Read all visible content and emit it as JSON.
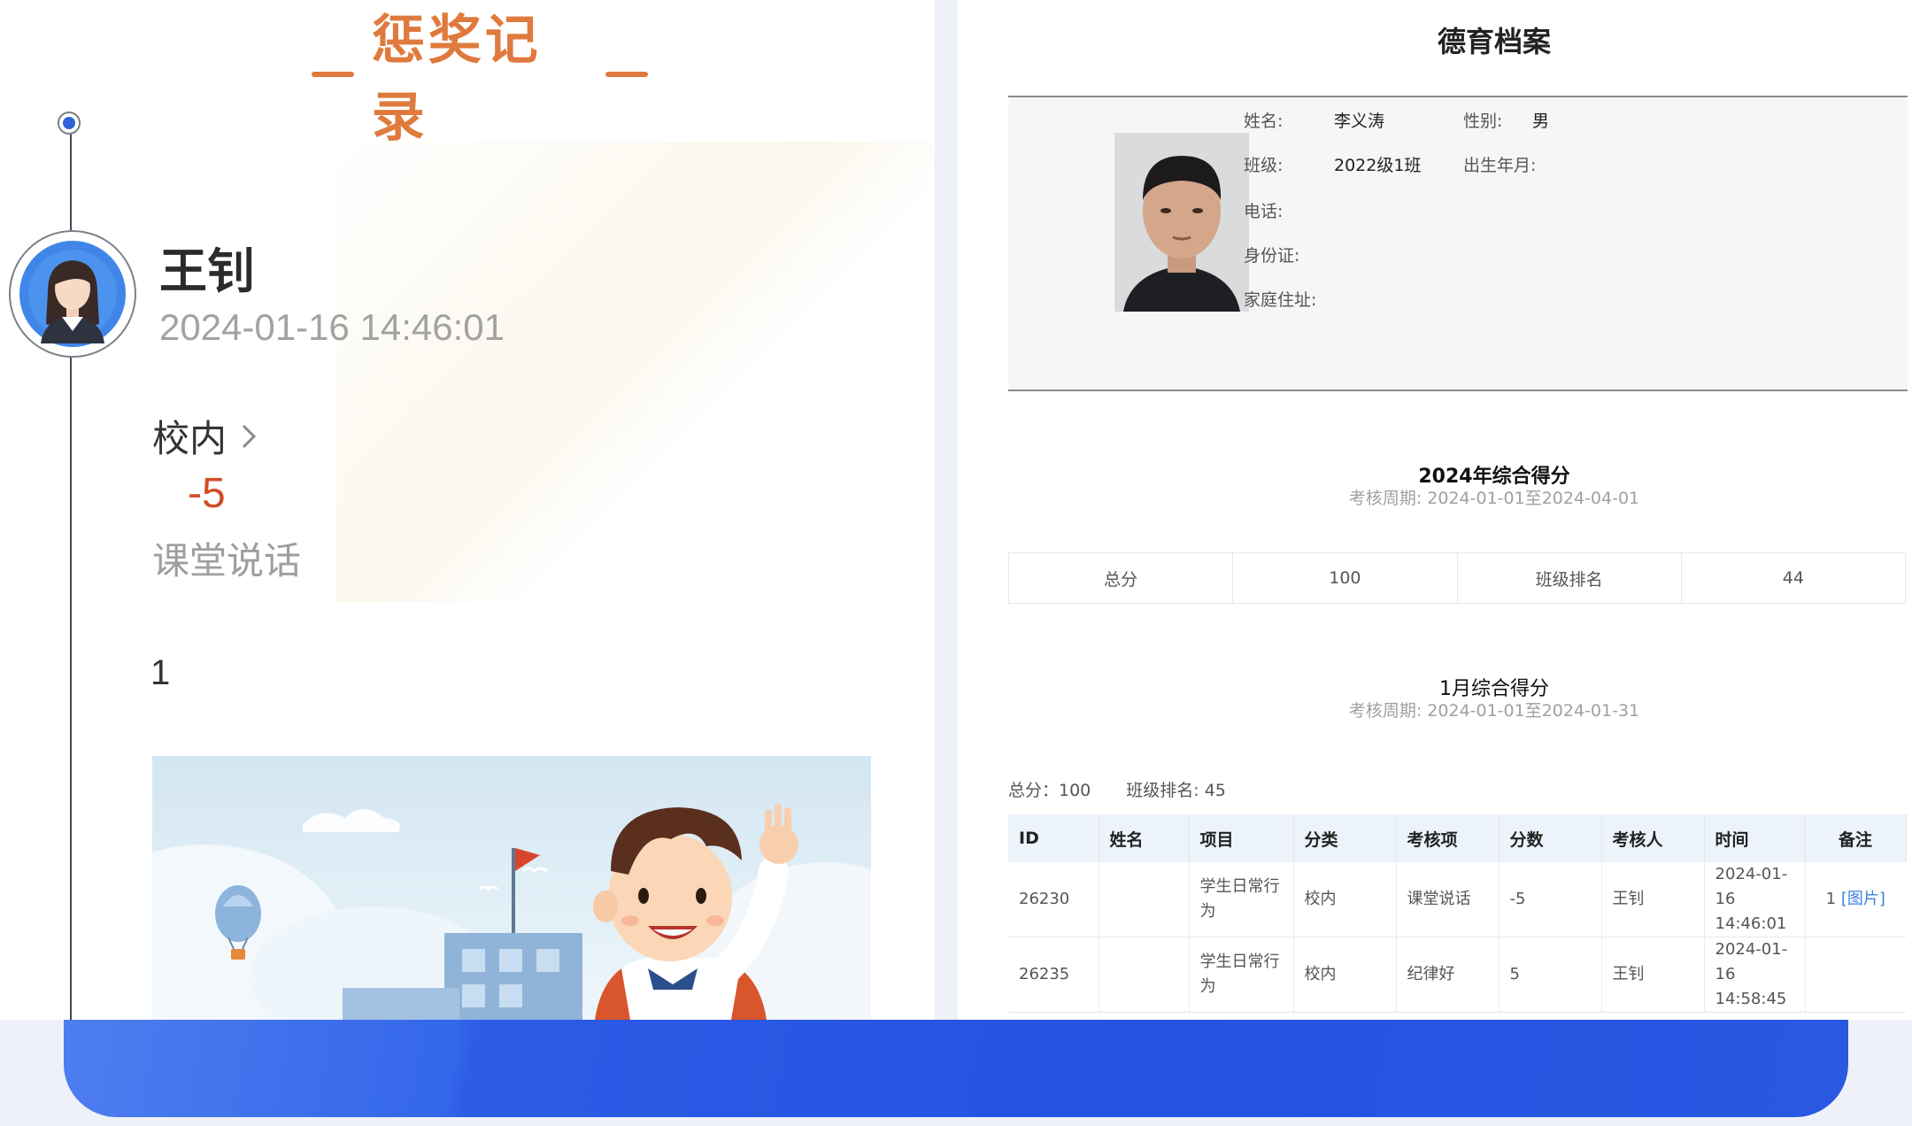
{
  "left": {
    "section_title": "惩奖记录",
    "record": {
      "person_name": "王钊",
      "datetime": "2024-01-16 14:46:01",
      "category": "校内",
      "score": "-5",
      "reason": "课堂说话",
      "remark": "1"
    }
  },
  "right": {
    "title": "德育档案",
    "profile": {
      "name_label": "姓名:",
      "name_value": "李义涛",
      "gender_label": "性别:",
      "gender_value": "男",
      "class_label": "班级:",
      "class_value": "2022级1班",
      "birth_label": "出生年月:",
      "phone_label": "电话:",
      "id_label": "身份证:",
      "address_label": "家庭住址:"
    },
    "yearly": {
      "title": "2024年综合得分",
      "period": "考核周期: 2024-01-01至2024-04-01",
      "total_label": "总分",
      "total_value": "100",
      "rank_label": "班级排名",
      "rank_value": "44"
    },
    "monthly": {
      "title": "1月综合得分",
      "period": "考核周期: 2024-01-01至2024-01-31",
      "total_text": "总分：100",
      "rank_text": "班级排名: 45"
    },
    "table": {
      "headers": [
        "ID",
        "姓名",
        "项目",
        "分类",
        "考核项",
        "分数",
        "考核人",
        "时间",
        "备注"
      ],
      "rows": [
        {
          "id": "26230",
          "name": "",
          "project": "学生日常行为",
          "category": "校内",
          "item": "课堂说话",
          "score": "-5",
          "assessor": "王钊",
          "time": "2024-01-16 14:46:01",
          "remark_num": "1",
          "remark_link": "[图片]"
        },
        {
          "id": "26235",
          "name": "",
          "project": "学生日常行为",
          "category": "校内",
          "item": "纪律好",
          "score": "5",
          "assessor": "王钊",
          "time": "2024-01-16 14:58:45",
          "remark_num": "",
          "remark_link": ""
        }
      ]
    }
  },
  "colors": {
    "title_orange": "#df7a3e",
    "score_red": "#d34d26",
    "accent_blue": "#2f62d9",
    "bar_blue": "#2552e0",
    "link_blue": "#3f7fe0"
  },
  "icons": [
    "timeline-node-icon",
    "female-avatar-icon",
    "chevron-right-icon",
    "student-photo",
    "boy-waving-illustration"
  ]
}
